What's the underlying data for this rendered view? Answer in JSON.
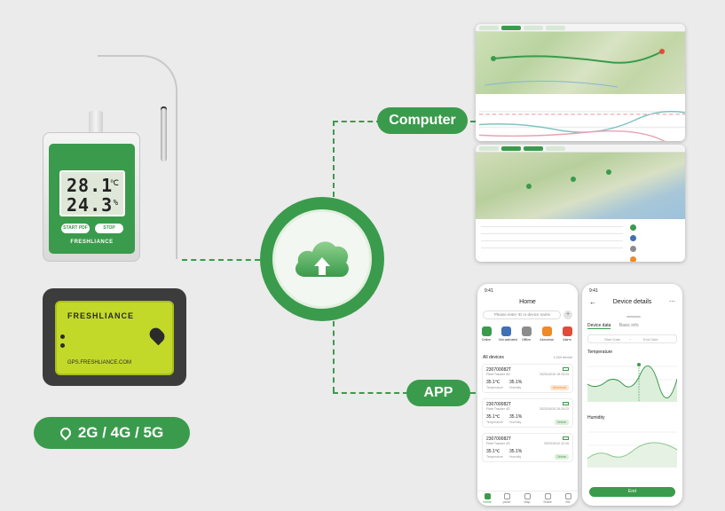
{
  "logger": {
    "lcd_temp": "28.1",
    "lcd_temp_unit": "℃",
    "lcd_humidity": "24.3",
    "lcd_humidity_unit": "%",
    "start_label": "START PDF",
    "stop_label": "STOP",
    "brand": "FRESHLIANCE"
  },
  "tracker": {
    "brand": "FRESHLIANCE",
    "website": "GPS.FRESHLIANCE.COM"
  },
  "network": {
    "label": "2G / 4G / 5G"
  },
  "labels": {
    "computer": "Computer",
    "app": "APP"
  },
  "colors": {
    "brand_green": "#3a9b4c",
    "tracker_lime": "#c3d92a"
  },
  "home_phone": {
    "time": "9:41",
    "title": "Home",
    "search_placeholder": "Please enter ID or device name",
    "quick_actions": [
      {
        "label": "Online",
        "color": "#3a9b4c"
      },
      {
        "label": "Not activated",
        "color": "#3f6fb5"
      },
      {
        "label": "Offline",
        "color": "#8c8c8c"
      },
      {
        "label": "Abnormal",
        "color": "#f08a24"
      },
      {
        "label": "Alarm",
        "color": "#e24b3a"
      }
    ],
    "all_devices_label": "All devices",
    "all_devices_count": "1,243 device",
    "devices": [
      {
        "id": "230700082T",
        "name": "Fleet Tracker 4G",
        "date": "2023/10/15 15:15:23",
        "temp": "35.1℃",
        "hum": "35.1%",
        "temp_label": "Temperature",
        "hum_label": "Humidity",
        "status": "Abnormal"
      },
      {
        "id": "230700082T",
        "name": "Fleet Tracker 4G",
        "date": "2023/10/15 15:15:23",
        "temp": "35.1℃",
        "hum": "35.1%",
        "temp_label": "Temperature",
        "hum_label": "Humidity",
        "status": "Online"
      },
      {
        "id": "230700082T",
        "name": "Fleet Tracker 4G",
        "date": "2023/10/12 12:15",
        "temp": "35.1℃",
        "hum": "35.1%",
        "temp_label": "Temperature",
        "hum_label": "Humidity",
        "status": "Online"
      }
    ],
    "nav": [
      "Home",
      "panel",
      "Map",
      "Share",
      "Me"
    ]
  },
  "details_phone": {
    "time": "9:41",
    "title": "Device details",
    "tabs": [
      "Device data",
      "Basic info"
    ],
    "start_date": "Start Date",
    "end_date": "End Date",
    "temperature_label": "Temperature",
    "humidity_label": "Humidity",
    "end_button": "End"
  }
}
